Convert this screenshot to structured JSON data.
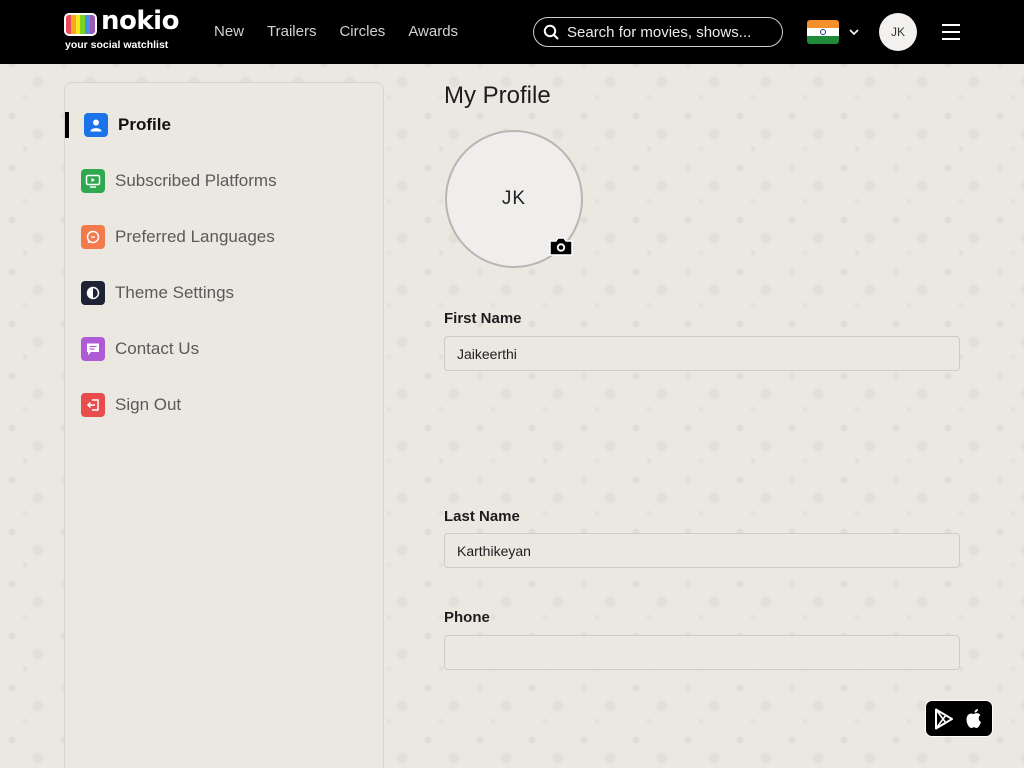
{
  "brand": {
    "name": "nokio",
    "tagline": "your social watchlist",
    "logo_colors": [
      "#e84a5f",
      "#f6a623",
      "#f8e71c",
      "#7ed321",
      "#4a90e2",
      "#9b59b6"
    ]
  },
  "nav": {
    "links": [
      {
        "label": "New"
      },
      {
        "label": "Trailers"
      },
      {
        "label": "Circles"
      },
      {
        "label": "Awards"
      }
    ]
  },
  "search": {
    "placeholder": "Search for movies, shows..."
  },
  "header": {
    "country_flag": "india-flag-icon",
    "user_initials": "JK"
  },
  "sidebar": {
    "items": [
      {
        "label": "Profile",
        "icon": "user-icon",
        "color": "#1a73e8",
        "active": true
      },
      {
        "label": "Subscribed Platforms",
        "icon": "tv-play-icon",
        "color": "#2fa84f"
      },
      {
        "label": "Preferred Languages",
        "icon": "language-bubble-icon",
        "color": "#f27a4c"
      },
      {
        "label": "Theme Settings",
        "icon": "theme-contrast-icon",
        "color": "#1e2235"
      },
      {
        "label": "Contact Us",
        "icon": "message-icon",
        "color": "#b05bd6"
      },
      {
        "label": "Sign Out",
        "icon": "sign-out-icon",
        "color": "#e84c4c"
      }
    ]
  },
  "profile": {
    "title": "My Profile",
    "avatar_initials": "JK",
    "first_name_label": "First Name",
    "first_name_value": "Jaikeerthi",
    "last_name_label": "Last Name",
    "last_name_value": "Karthikeyan",
    "phone_label": "Phone",
    "phone_value": ""
  },
  "app_badge": {
    "icons": [
      "google-play-icon",
      "apple-icon"
    ]
  }
}
